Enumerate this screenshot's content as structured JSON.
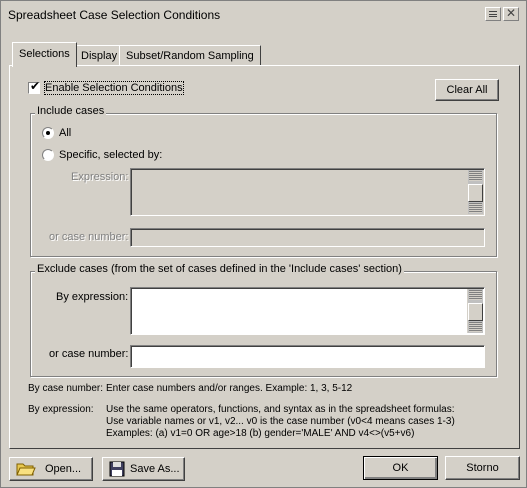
{
  "window": {
    "title": "Spreadsheet Case Selection Conditions"
  },
  "tabs": [
    {
      "label": "Selections",
      "active": true
    },
    {
      "label": "Display",
      "active": false
    },
    {
      "label": "Subset/Random Sampling",
      "active": false
    }
  ],
  "enable": {
    "label": "Enable Selection Conditions",
    "checked": true
  },
  "clear_all": {
    "label": "Clear All"
  },
  "include": {
    "legend": "Include cases",
    "all_label": "All",
    "specific_label": "Specific, selected by:",
    "selected": "All",
    "expression_label": "Expression:",
    "expression_value": "",
    "case_number_label": "or case number:",
    "case_number_value": ""
  },
  "exclude": {
    "legend": "Exclude cases (from the set of cases defined in the 'Include cases' section)",
    "by_expression_label": "By expression:",
    "expression_value": "",
    "case_number_label": "or case number:",
    "case_number_value": ""
  },
  "help": {
    "case_number_key": "By case number:",
    "case_number_text": "Enter case numbers and/or ranges.   Example:  1, 3, 5-12",
    "expression_key": "By expression:",
    "expression_line1": "Use the same operators, functions, and syntax as in the spreadsheet formulas:",
    "expression_line2": "Use variable names or v1, v2...    v0 is the case number  (v0<4 means cases 1-3)",
    "expression_line3": "Examples:   (a)  v1=0  OR  age>18   (b)  gender='MALE'  AND  v4<>(v5+v6)"
  },
  "footer": {
    "open_label": "Open...",
    "save_label": "Save As...",
    "ok_label": "OK",
    "cancel_label": "Storno"
  }
}
